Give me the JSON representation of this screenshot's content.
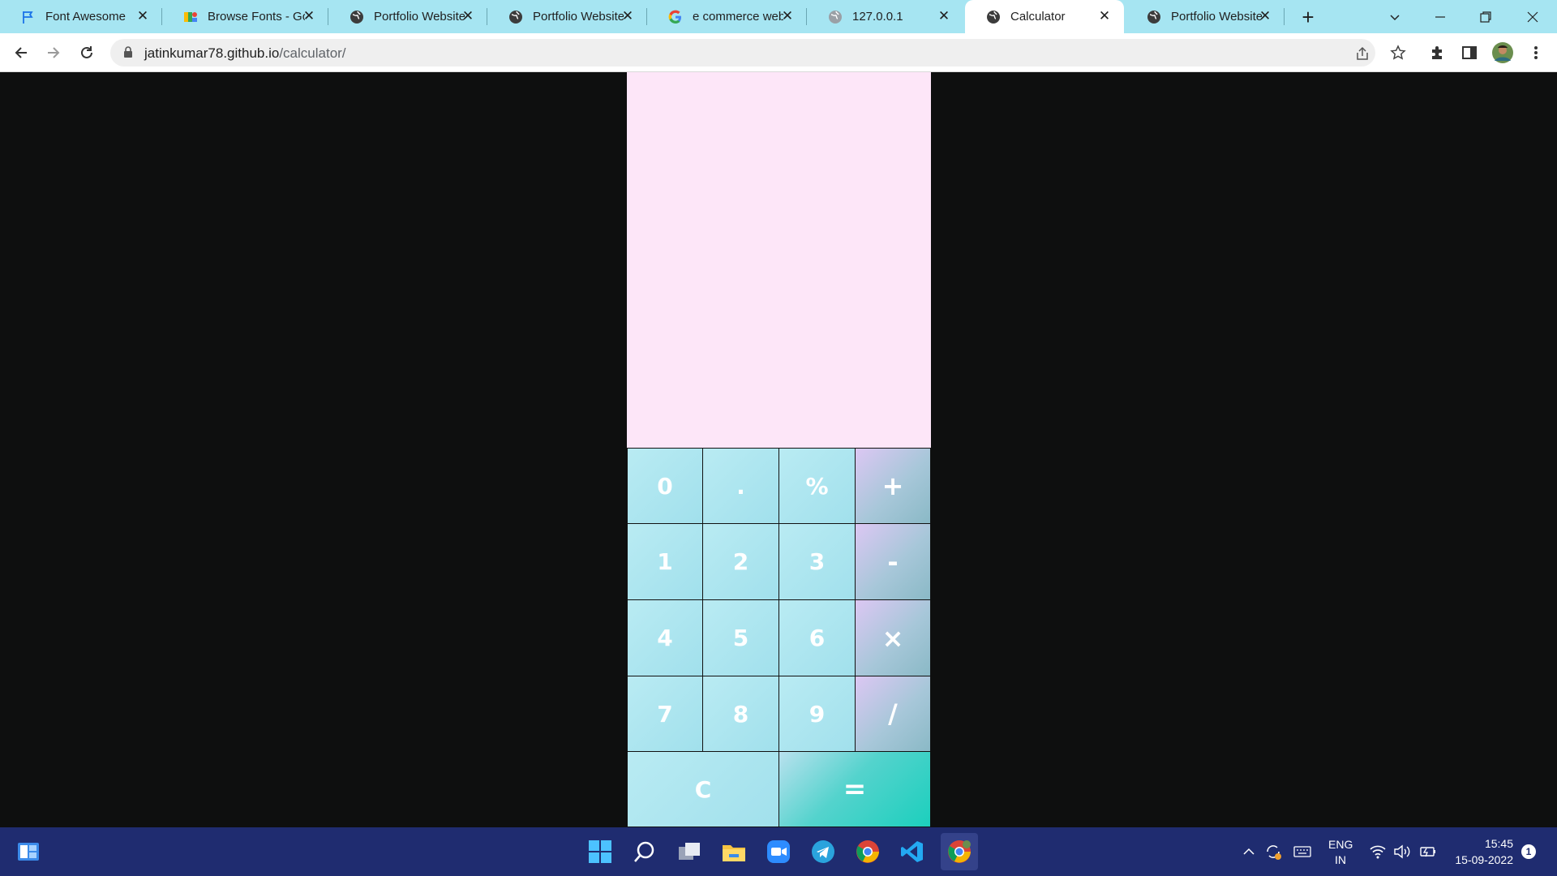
{
  "browser": {
    "tabs": [
      {
        "title": "Font Awesome",
        "icon": "flag-icon"
      },
      {
        "title": "Browse Fonts - Go",
        "icon": "google-fonts-icon"
      },
      {
        "title": "Portfolio Website",
        "icon": "globe-icon"
      },
      {
        "title": "Portfolio Website",
        "icon": "globe-icon"
      },
      {
        "title": "e commerce webs",
        "icon": "google-icon"
      },
      {
        "title": "127.0.0.1",
        "icon": "globe-icon"
      },
      {
        "title": "Calculator",
        "icon": "globe-icon",
        "active": true
      },
      {
        "title": "Portfolio Website",
        "icon": "globe-icon"
      }
    ],
    "url_host": "jatinkumar78.github.io",
    "url_path": "/calculator/"
  },
  "calculator": {
    "display_value": "",
    "keys": {
      "k0": "0",
      "dot": ".",
      "percent": "%",
      "plus": "+",
      "k1": "1",
      "k2": "2",
      "k3": "3",
      "minus": "-",
      "k4": "4",
      "k5": "5",
      "k6": "6",
      "multiply": "×",
      "k7": "7",
      "k8": "8",
      "k9": "9",
      "divide": "/",
      "clear": "C",
      "equals": "="
    },
    "colors": {
      "display_bg": "#fde6f8",
      "key_bg": "#a9e4ef",
      "page_bg": "#0e0f0f"
    }
  },
  "taskbar": {
    "language": "ENG",
    "region": "IN",
    "time": "15:45",
    "date": "15-09-2022",
    "notification_count": "1"
  }
}
